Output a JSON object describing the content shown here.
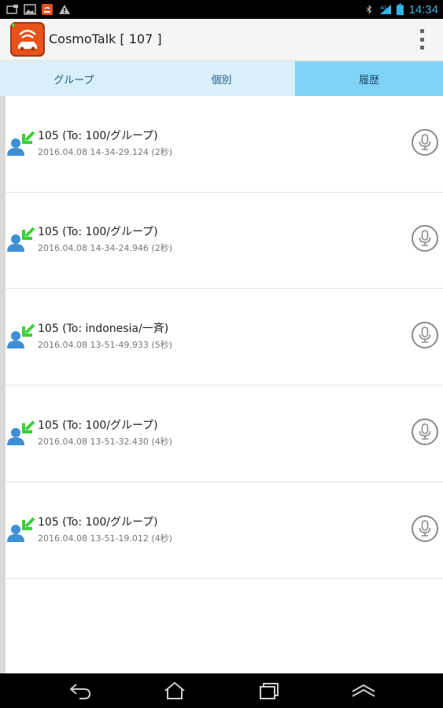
{
  "status_bar": {
    "left_icons": [
      "screenshot-icon",
      "picture-icon",
      "cosmotalk-notification-icon",
      "warning-icon"
    ],
    "right_icons": [
      "bluetooth-icon",
      "wifi-icon",
      "battery-icon"
    ],
    "time": "14:34"
  },
  "app_bar": {
    "title": "CosmoTalk [ 107 ]",
    "icon": "cosmotalk-app-icon",
    "menu_icon": "overflow-menu-icon"
  },
  "tabs": [
    {
      "label": "グループ",
      "active": false
    },
    {
      "label": "個別",
      "active": false
    },
    {
      "label": "履歴",
      "active": true
    }
  ],
  "history": [
    {
      "title": "105 (To: 100/グループ)",
      "subtitle": "2016.04.08 14-34-29.124 (2秒)"
    },
    {
      "title": "105 (To: 100/グループ)",
      "subtitle": "2016.04.08 14-34-24.946 (2秒)"
    },
    {
      "title": "105 (To: indonesia/一斉)",
      "subtitle": "2016.04.08 13-51-49.933 (5秒)"
    },
    {
      "title": "105 (To: 100/グループ)",
      "subtitle": "2016.04.08 13-51-32.430 (4秒)"
    },
    {
      "title": "105 (To: 100/グループ)",
      "subtitle": "2016.04.08 13-51-19.012 (4秒)"
    }
  ],
  "nav_bar": {
    "buttons": [
      "back-icon",
      "home-icon",
      "recent-apps-icon",
      "menu-up-icon"
    ]
  },
  "colors": {
    "accent": "#33b5e5",
    "tab_bg": "#d7f0fb",
    "tab_active": "#7fd3f6",
    "incoming_arrow": "#3ad13a",
    "avatar_blue": "#3d8fd6"
  }
}
